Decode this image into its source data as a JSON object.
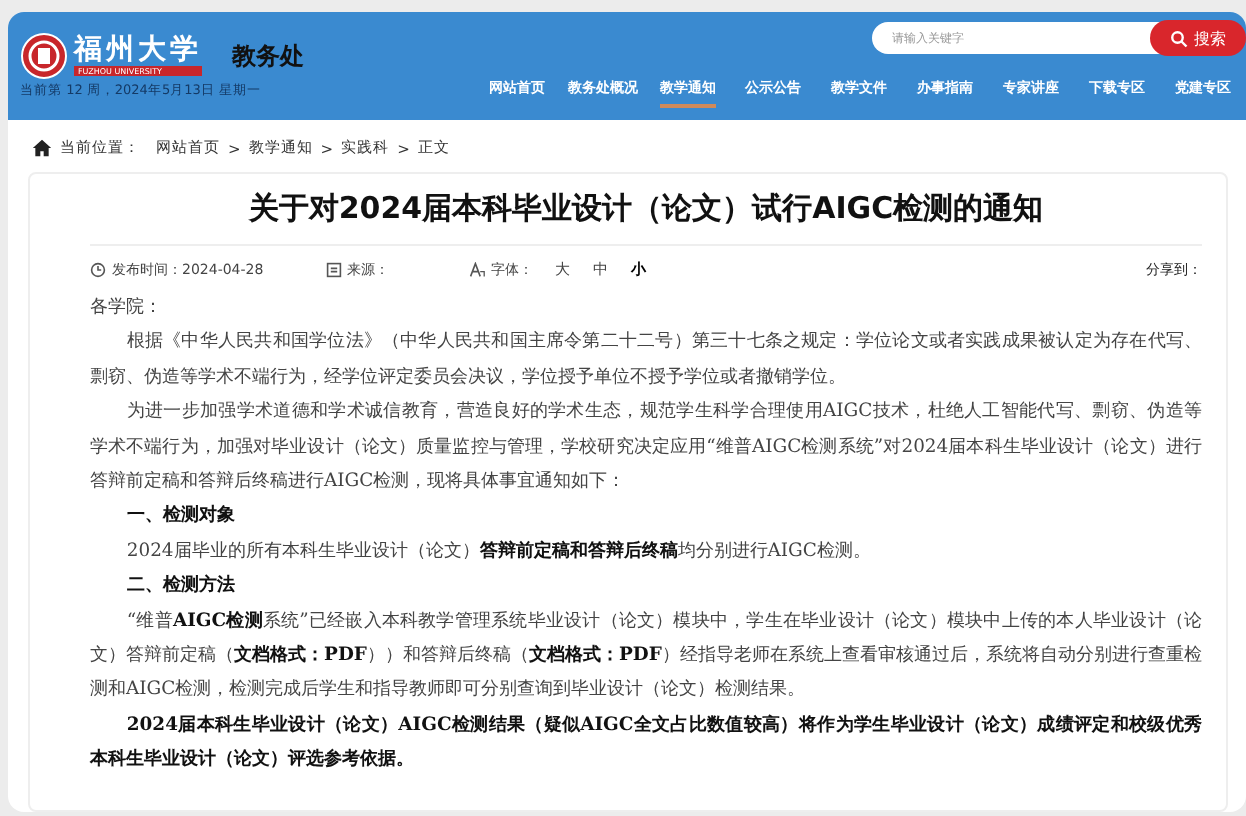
{
  "header": {
    "logo_text": "福州大学",
    "logo_subtext": "FUZHOU UNIVERSITY",
    "department": "教务处",
    "week_info": "当前第 12 周，2024年5月13日 星期一",
    "search": {
      "placeholder": "请输入关键字",
      "button": "搜索"
    },
    "nav": [
      {
        "label": "网站首页",
        "selected": false
      },
      {
        "label": "教务处概况",
        "selected": false
      },
      {
        "label": "教学通知",
        "selected": true
      },
      {
        "label": "公示公告",
        "selected": false
      },
      {
        "label": "教学文件",
        "selected": false
      },
      {
        "label": "办事指南",
        "selected": false
      },
      {
        "label": "专家讲座",
        "selected": false
      },
      {
        "label": "下载专区",
        "selected": false
      },
      {
        "label": "党建专区",
        "selected": false
      }
    ]
  },
  "breadcrumb": {
    "label": "当前位置：",
    "items": [
      "网站首页",
      "教学通知",
      "实践科",
      "正文"
    ],
    "separator": ">"
  },
  "article": {
    "title": "关于对2024届本科毕业设计（论文）试行AIGC检测的通知",
    "meta": {
      "published": "发布时间：2024-04-28",
      "source": "来源：",
      "font_label": "字体：",
      "font_sizes": [
        {
          "label": "大",
          "selected": false
        },
        {
          "label": "中",
          "selected": false
        },
        {
          "label": "小",
          "selected": true
        }
      ],
      "share": "分享到："
    },
    "paragraphs": [
      {
        "kind": "plain",
        "text": "各学院："
      },
      {
        "kind": "indent",
        "text": "根据《中华人民共和国学位法》（中华人民共和国主席令第二十二号）第三十七条之规定：学位论文或者实践成果被认定为存在代写、剽窃、伪造等学术不端行为，经学位评定委员会决议，学位授予单位不授予学位或者撤销学位。"
      },
      {
        "kind": "indent",
        "text": "为进一步加强学术道德和学术诚信教育，营造良好的学术生态，规范学生科学合理使用AIGC技术，杜绝人工智能代写、剽窃、伪造等学术不端行为，加强对毕业设计（论文）质量监控与管理，学校研究决定应用“维普AIGC检测系统”对2024届本科生毕业设计（论文）进行答辩前定稿和答辩后终稿进行AIGC检测，现将具体事宜通知如下："
      },
      {
        "kind": "heading",
        "text": "一、检测对象"
      },
      {
        "kind": "indent",
        "text": "2024届毕业的所有本科生毕业设计（论文）**答辩前定稿和答辩后终稿**均分别进行AIGC检测。"
      },
      {
        "kind": "heading",
        "text": "二、检测方法"
      },
      {
        "kind": "indent",
        "text": "“维普**AIGC检测**系统”已经嵌入本科教学管理系统毕业设计（论文）模块中，学生在毕业设计（论文）模块中上传的本人毕业设计（论文）答辩前定稿（**文档格式：PDF**））和答辩后终稿（**文档格式：PDF**）经指导老师在系统上查看审核通过后，系统将自动分别进行查重检测和AIGC检测，检测完成后学生和指导教师即可分别查询到毕业设计（论文）检测结果。"
      },
      {
        "kind": "bold",
        "text": "2024届本科生毕业设计（论文）AIGC检测结果（疑似AIGC全文占比数值较高）将作为学生毕业设计（论文）成绩评定和校级优秀本科生毕业设计（论文）评选参考依据。"
      }
    ]
  }
}
